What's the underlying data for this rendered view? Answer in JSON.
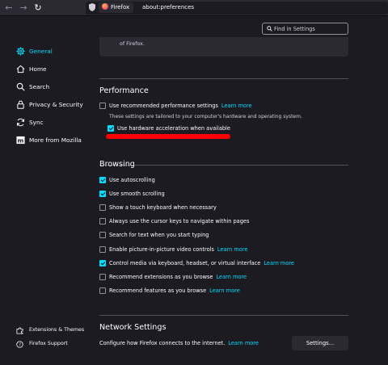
{
  "browser": {
    "identity_label": "Firefox",
    "url": "about:preferences"
  },
  "sidebar": {
    "items": [
      {
        "label": "General",
        "icon": "gear-icon",
        "active": true
      },
      {
        "label": "Home",
        "icon": "home-icon",
        "active": false
      },
      {
        "label": "Search",
        "icon": "search-icon",
        "active": false
      },
      {
        "label": "Privacy & Security",
        "icon": "lock-icon",
        "active": false
      },
      {
        "label": "Sync",
        "icon": "sync-icon",
        "active": false
      },
      {
        "label": "More from Mozilla",
        "icon": "mozilla-icon",
        "active": false
      }
    ],
    "footer": [
      {
        "label": "Extensions & Themes",
        "icon": "puzzle-icon"
      },
      {
        "label": "Firefox Support",
        "icon": "help-icon"
      }
    ]
  },
  "search": {
    "placeholder": "Find in Settings"
  },
  "previous_section": {
    "trailing_text": "of Firefox."
  },
  "performance": {
    "title": "Performance",
    "recommended": {
      "label": "Use recommended performance settings",
      "checked": false,
      "link": "Learn more"
    },
    "hint": "These settings are tailored to your computer's hardware and operating system.",
    "hardware_accel": {
      "label": "Use hardware acceleration when available",
      "checked": true
    }
  },
  "browsing": {
    "title": "Browsing",
    "options": [
      {
        "label": "Use autoscrolling",
        "checked": true,
        "link": ""
      },
      {
        "label": "Use smooth scrolling",
        "checked": true,
        "link": ""
      },
      {
        "label": "Show a touch keyboard when necessary",
        "checked": false,
        "link": ""
      },
      {
        "label": "Always use the cursor keys to navigate within pages",
        "checked": false,
        "link": ""
      },
      {
        "label": "Search for text when you start typing",
        "checked": false,
        "link": ""
      },
      {
        "label": "Enable picture-in-picture video controls",
        "checked": false,
        "link": "Learn more"
      },
      {
        "label": "Control media via keyboard, headset, or virtual interface",
        "checked": true,
        "link": "Learn more"
      },
      {
        "label": "Recommend extensions as you browse",
        "checked": false,
        "link": "Learn more"
      },
      {
        "label": "Recommend features as you browse",
        "checked": false,
        "link": "Learn more"
      }
    ]
  },
  "network": {
    "title": "Network Settings",
    "description": "Configure how Firefox connects to the internet.",
    "link": "Learn more",
    "button": "Settings..."
  },
  "colors": {
    "accent": "#00ddff",
    "background": "#1c1b22",
    "annotation": "#ff0000"
  }
}
